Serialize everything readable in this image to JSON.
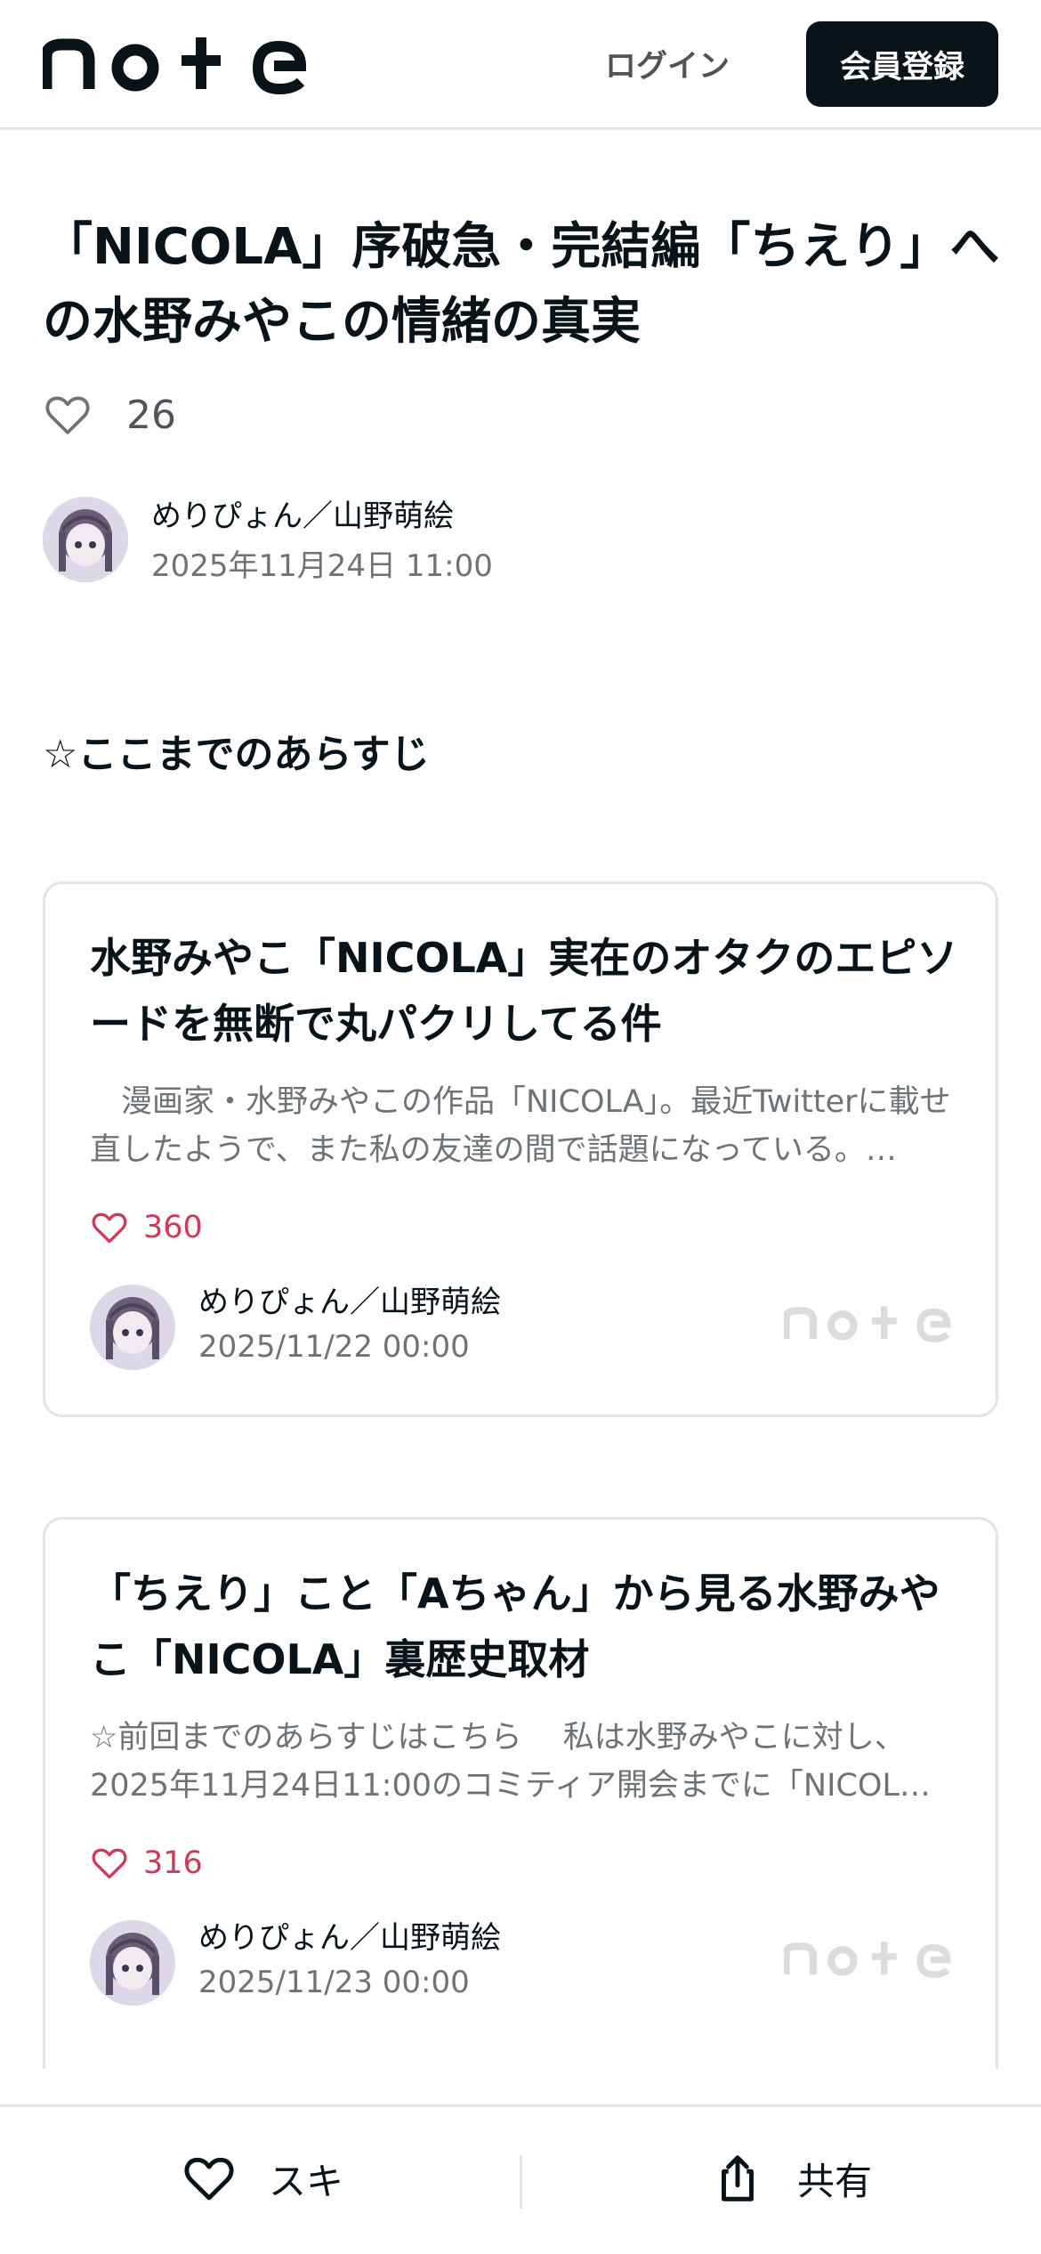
{
  "header": {
    "logo_text": "note",
    "login_label": "ログイン",
    "signup_label": "会員登録"
  },
  "article": {
    "title": "「NICOLA」序破急・完結編「ちえり」への水野みやこの情緒の真実",
    "like_count": "26",
    "author": "めりぴょん／山野萌絵",
    "date": "2025年11月24日 11:00"
  },
  "section": {
    "star": "☆",
    "heading": "ここまでのあらすじ"
  },
  "embeds": [
    {
      "title": "水野みやこ「NICOLA」実在のオタクのエピソードを無断で丸パクリしてる件",
      "excerpt": "　漫画家・水野みやこの作品「NICOLA」。最近Twitterに載せ直したようで、また私の友達の間で話題になっている。…",
      "likes": "360",
      "author": "めりぴょん／山野萌絵",
      "date": "2025/11/22 00:00",
      "logo_text": "note"
    },
    {
      "title": "「ちえり」こと「Aちゃん」から見る水野みやこ「NICOLA」裏歴史取材",
      "excerpt": "☆前回までのあらすじはこちら　 私は水野みやこに対し、2025年11月24日11:00のコミティア開会までに「NICOL…",
      "likes": "316",
      "author": "めりぴょん／山野萌絵",
      "date": "2025/11/23 00:00",
      "logo_text": "note"
    }
  ],
  "bottom_bar": {
    "like_label": "スキ",
    "share_label": "共有"
  },
  "colors": {
    "primary": "#08131a",
    "like_accent": "#cf3a5b",
    "muted_text": "#6e7378",
    "border": "#e4e4e4"
  }
}
